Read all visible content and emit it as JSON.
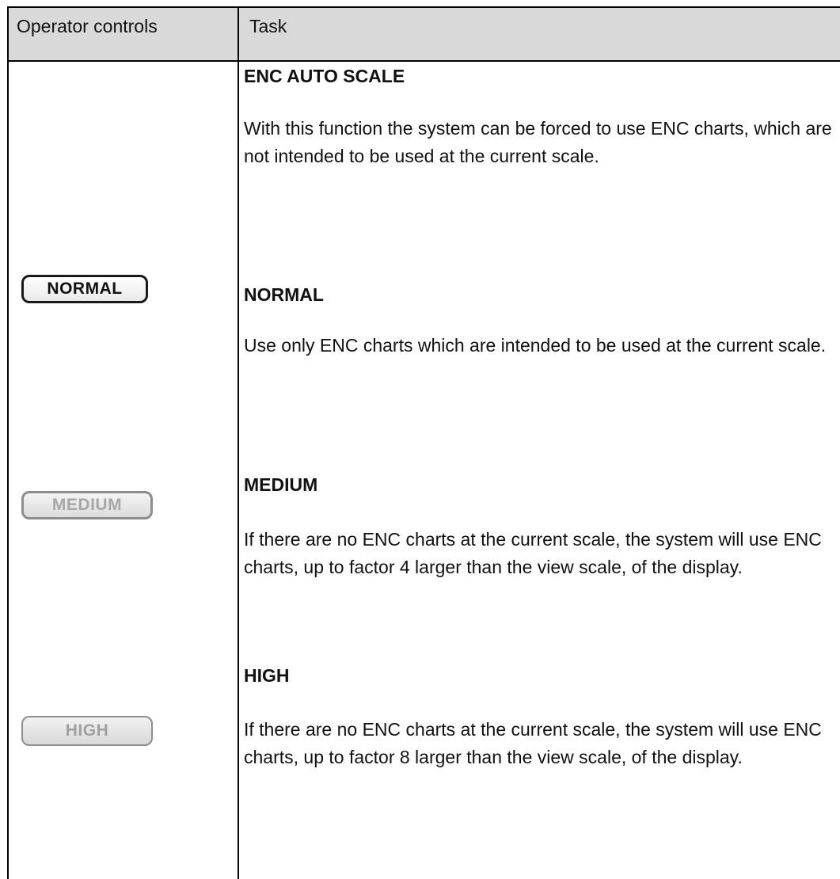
{
  "header": {
    "col1": "Operator controls",
    "col2": "Task"
  },
  "sections": [
    {
      "title": "ENC AUTO SCALE",
      "text": "With this function the system can be forced to use ENC charts, which are not intended to be used at the current scale."
    },
    {
      "title": "NORMAL",
      "text": "Use only ENC charts which are intended to be used at the current scale."
    },
    {
      "title": "MEDIUM",
      "text": "If there are no ENC charts at the current scale, the system will use ENC charts, up to factor 4 larger than the view scale, of the display."
    },
    {
      "title": "HIGH",
      "text": "If there are no ENC charts at the current scale, the system will use ENC charts, up to factor 8 larger than the view scale, of the display."
    }
  ],
  "controls": {
    "normal_label": "NORMAL",
    "medium_label": "MEDIUM",
    "high_label": "HIGH"
  }
}
